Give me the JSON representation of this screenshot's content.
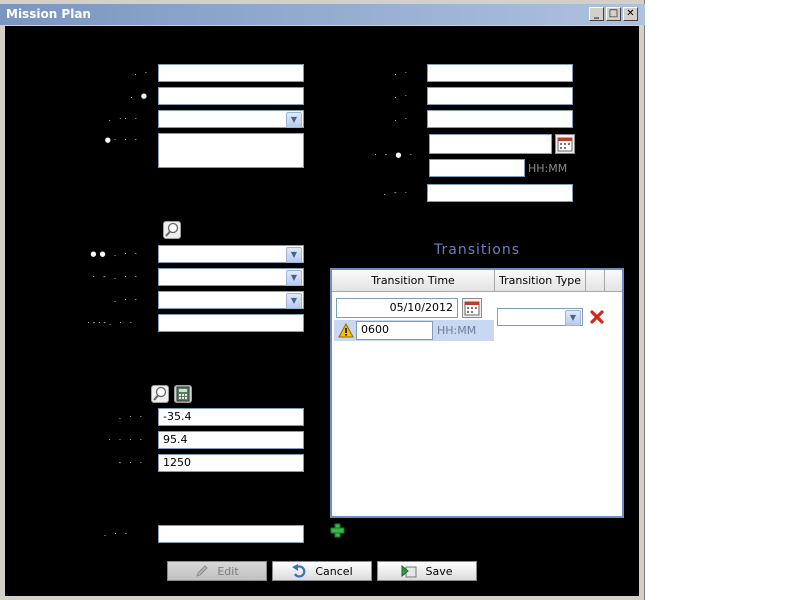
{
  "window": {
    "title": "Mission Plan"
  },
  "left_form": {
    "coord1": "-35.4",
    "coord2": "95.4",
    "coord3": "1250"
  },
  "right_form": {
    "time_unit": "HH:MM"
  },
  "transitions": {
    "title": "Transitions",
    "columns": [
      "Transition Time",
      "Transition Type"
    ],
    "row": {
      "date": "05/10/2012",
      "time": "0600",
      "time_unit": "HH:MM"
    }
  },
  "buttons": {
    "edit": "Edit",
    "cancel": "Cancel",
    "save": "Save"
  },
  "colors": {
    "titlebar": "#7a96c0",
    "grid_border": "#6f8fc4",
    "accent": "#6a7fbf"
  }
}
